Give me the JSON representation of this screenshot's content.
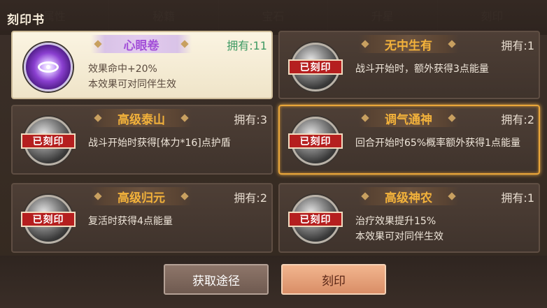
{
  "panel": {
    "title": "刻印书"
  },
  "background_tabs": [
    "属性",
    "秘籍",
    "宝石",
    "升星",
    "刻印"
  ],
  "cards": [
    {
      "name": "心眼卷",
      "owned": "拥有:11",
      "desc": "效果命中+20%\n本效果可对同伴生效",
      "engraved": false,
      "stamp": "",
      "icon": "eye-icon",
      "style": "light"
    },
    {
      "name": "无中生有",
      "owned": "拥有:1",
      "desc": "战斗开始时，额外获得3点能量",
      "engraved": true,
      "stamp": "已刻印",
      "icon": "skill-orb-icon"
    },
    {
      "name": "高级泰山",
      "owned": "拥有:3",
      "desc": "战斗开始时获得[体力*16]点护盾",
      "engraved": true,
      "stamp": "已刻印",
      "icon": "skill-orb-icon"
    },
    {
      "name": "调气通神",
      "owned": "拥有:2",
      "desc": "回合开始时65%概率额外获得1点能量",
      "engraved": true,
      "stamp": "已刻印",
      "icon": "skill-orb-icon",
      "selected": true
    },
    {
      "name": "高级归元",
      "owned": "拥有:2",
      "desc": "复活时获得4点能量",
      "engraved": true,
      "stamp": "已刻印",
      "icon": "skill-orb-icon"
    },
    {
      "name": "高级神农",
      "owned": "拥有:1",
      "desc": "治疗效果提升15%\n本效果可对同伴生效",
      "engraved": true,
      "stamp": "已刻印",
      "icon": "skill-orb-icon"
    }
  ],
  "buttons": {
    "get_path": "获取途径",
    "engrave": "刻印"
  },
  "colors": {
    "accent": "#f3b23b",
    "selected_border": "#e9a63a",
    "stamp_red": "#b51f1f"
  }
}
